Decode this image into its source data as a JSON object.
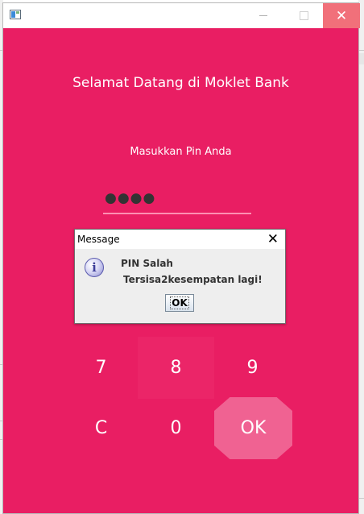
{
  "window": {
    "title": "",
    "welcome": "Selamat Datang di Moklet Bank",
    "pin_label": "Masukkan Pin Anda",
    "pin_masked": "●●●●",
    "keypad": {
      "k7": "7",
      "k8": "8",
      "k9": "9",
      "kc": "C",
      "k0": "0",
      "ok": "OK"
    }
  },
  "dialog": {
    "title": "Message",
    "close": "✕",
    "line1": "PIN Salah",
    "line2": "Tersisa2kesempatan lagi!",
    "ok_label": "OK",
    "icon": "info-icon"
  },
  "colors": {
    "window_bg": "#e91e63",
    "ok_key_bg": "#f06292",
    "close_hover": "#f1707a"
  }
}
